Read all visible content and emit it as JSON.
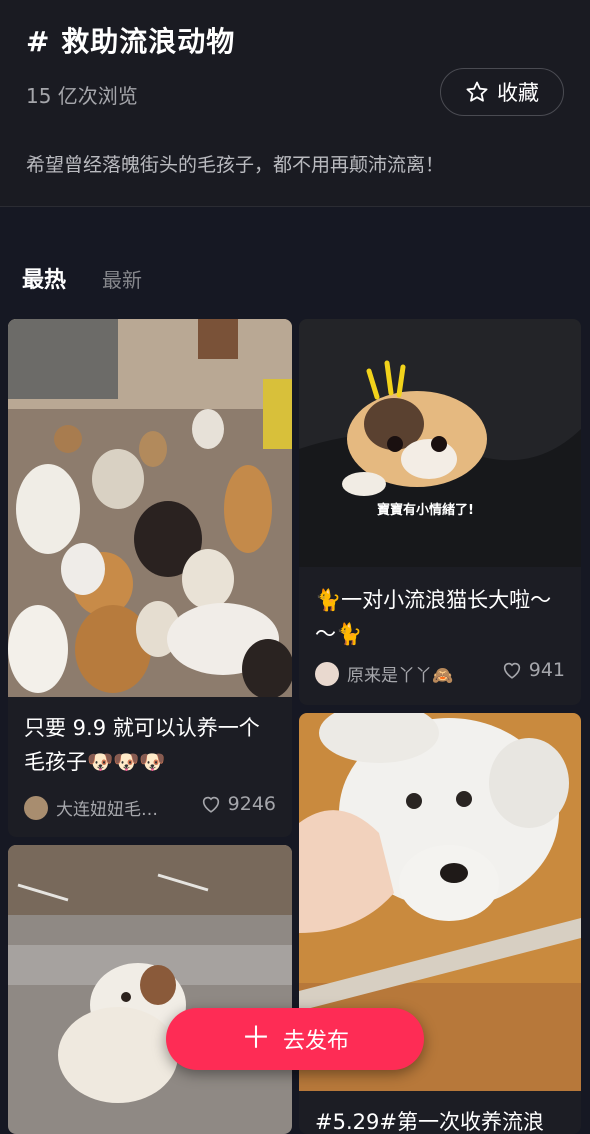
{
  "topic": {
    "title": "# 救助流浪动物",
    "views": "15 亿次浏览",
    "favorite_label": "收藏",
    "description": "希望曾经落魄街头的毛孩子，都不用再颠沛流离！"
  },
  "tabs": {
    "hot": "最热",
    "new": "最新"
  },
  "cards": [
    {
      "title": "只要 9.9 就可以认养一个毛孩子🐶🐶🐶",
      "author": "大连妞妞毛…",
      "likes": "9246"
    },
    {
      "title": "🐈一对小流浪猫长大啦～～🐈",
      "image_caption": "寶寶有小情緒了!",
      "author": "原来是丫丫🙈",
      "likes": "941"
    },
    {
      "title": "#5.29#第一次收养流浪"
    },
    {}
  ],
  "publish": {
    "label": "去发布"
  },
  "colors": {
    "accent": "#fe2c55",
    "background": "#161823"
  }
}
